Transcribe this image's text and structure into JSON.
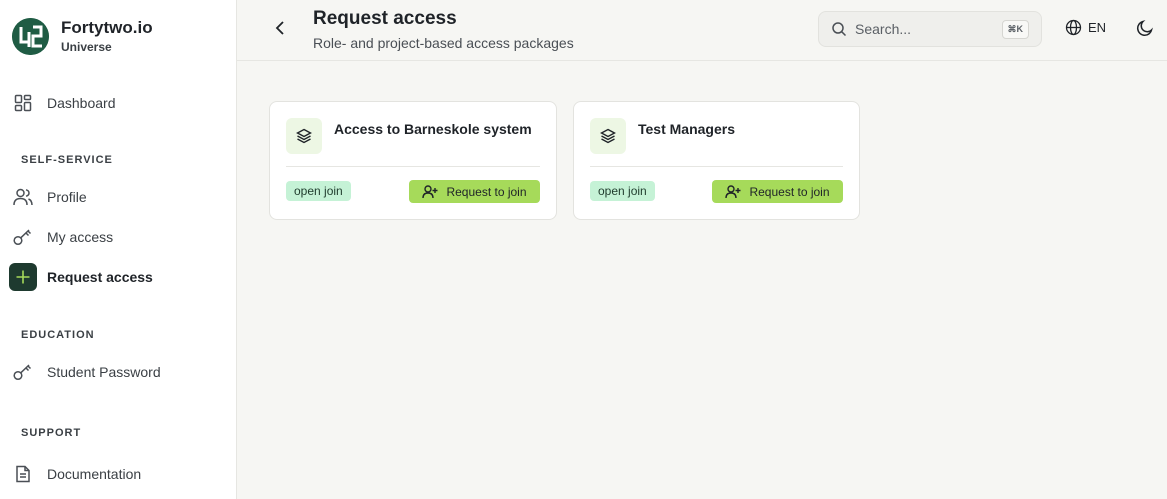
{
  "brand": {
    "name": "Fortytwo.io",
    "subtitle": "Universe"
  },
  "sidebar": {
    "dashboard": {
      "label": "Dashboard",
      "icon": "dashboard-icon"
    },
    "sections": {
      "self_service": "SELF-SERVICE",
      "education": "EDUCATION",
      "support": "SUPPORT"
    },
    "items": [
      {
        "label": "Profile",
        "icon": "users-icon"
      },
      {
        "label": "My access",
        "icon": "key-icon"
      },
      {
        "label": "Request access",
        "icon": "plus-icon",
        "active": true
      },
      {
        "label": "Student Password",
        "icon": "key-icon"
      },
      {
        "label": "Documentation",
        "icon": "document-icon"
      }
    ]
  },
  "header": {
    "title": "Request access",
    "subtitle": "Role- and project-based access packages",
    "search_placeholder": "Search...",
    "search_shortcut": "⌘K",
    "language": "EN"
  },
  "cards": [
    {
      "title": "Access to Barneskole system",
      "badge": "open join",
      "button": "Request to join"
    },
    {
      "title": "Test Managers",
      "badge": "open join",
      "button": "Request to join"
    }
  ],
  "colors": {
    "accent_button": "#a6da5a",
    "badge": "#c5f2d6",
    "active_nav": "#1e3a2f",
    "logo": "#1f5c44"
  }
}
